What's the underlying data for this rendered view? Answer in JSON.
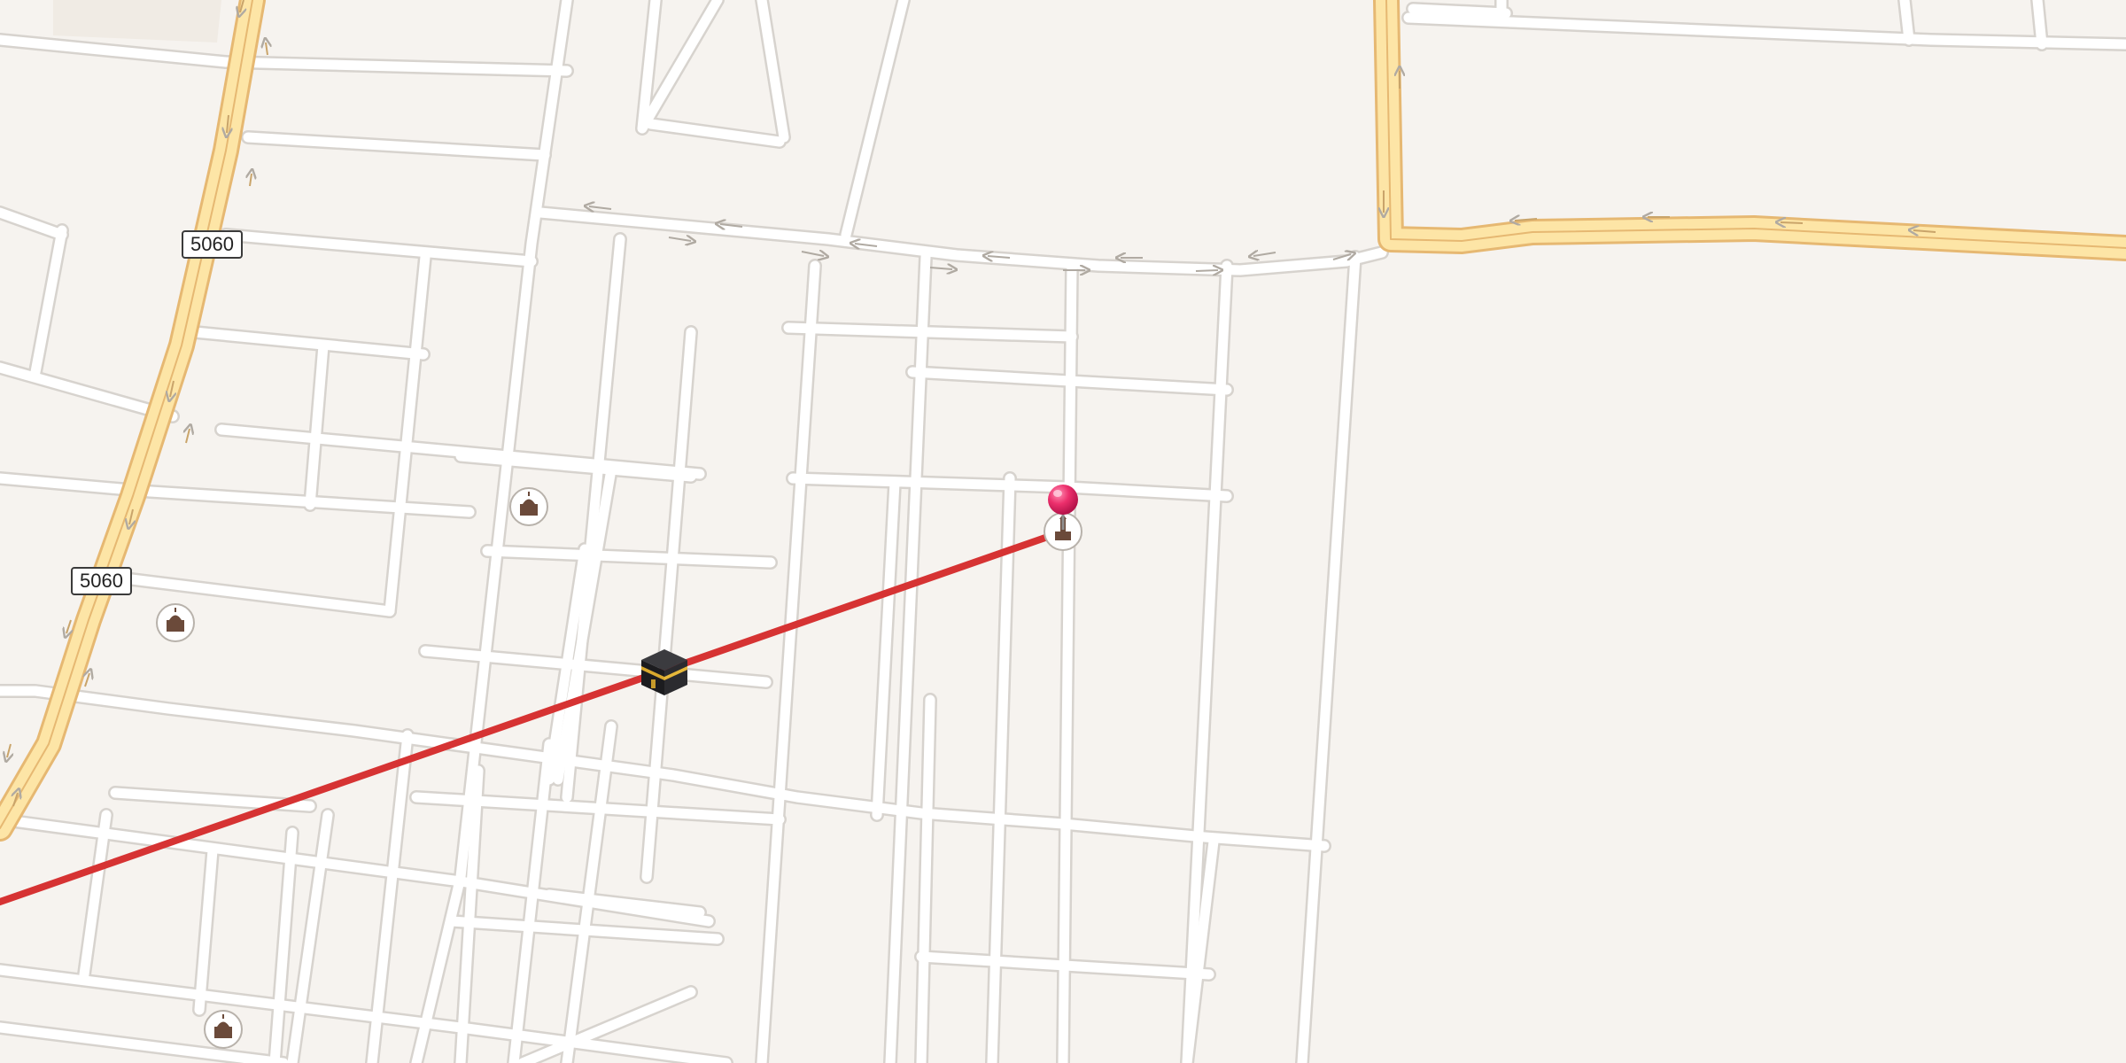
{
  "map": {
    "colors": {
      "background": "#f6f3ef",
      "street_casing": "#d7d3ce",
      "street_fill": "#ffffff",
      "major_road_casing": "#e6b872",
      "major_road_fill": "#fde5a6",
      "qibla_line": "#d63333",
      "pin": "#e0245e"
    },
    "road_labels": [
      {
        "text": "5060"
      },
      {
        "text": "5060"
      }
    ],
    "markers": {
      "kaaba": {
        "icon": "kaaba-icon"
      },
      "location_pin": {
        "icon": "map-pin-icon"
      },
      "mosques": [
        {
          "icon": "mosque-icon"
        },
        {
          "icon": "mosque-icon"
        },
        {
          "icon": "mosque-icon"
        },
        {
          "icon": "mosque-minaret-icon"
        }
      ]
    }
  }
}
